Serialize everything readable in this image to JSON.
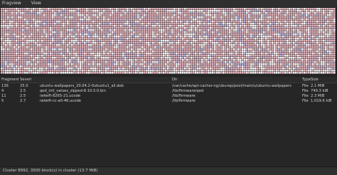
{
  "menu": {
    "items": [
      "Fragview",
      "View"
    ]
  },
  "colors": {
    "fragmented": "#e6b7bf",
    "contiguous": "#ffffff",
    "mixed": "#b8b6e4",
    "empty": "#f0efef",
    "background": "#242424"
  },
  "table": {
    "columns": [
      "Fragments",
      "Severity",
      "",
      "Dir",
      "Type",
      "Size"
    ],
    "rows": [
      {
        "fragments": "136",
        "severity": "25.0",
        "name": "ubuntu-wallpapers_20.04.2-0ubuntu1_all.deb",
        "dir": "/var/cache/apt-cacher-ng/uburep/pool/main/u/ubuntu-wallpapers",
        "type": "File",
        "size": "2.1 MiB"
      },
      {
        "fragments": "4",
        "severity": "2.5",
        "name": "qed_init_values_zipped-8.10.5.0.bin",
        "dir": "/lib/firmware/qed",
        "type": "File",
        "size": "749.3 kiB"
      },
      {
        "fragments": "11",
        "severity": "2.5",
        "name": "iwlwifi-8265-21.ucode",
        "dir": "/lib/firmware",
        "type": "File",
        "size": "2.3 MiB"
      },
      {
        "fragments": "5",
        "severity": "2.7",
        "name": "iwlwifi-cc-a0-46.ucode",
        "dir": "/lib/firmware",
        "type": "File",
        "size": "1,019.6 kiB"
      }
    ]
  },
  "status": {
    "text": "Cluster 8992, 3500 block(s) in cluster (13.7 MiB)"
  }
}
